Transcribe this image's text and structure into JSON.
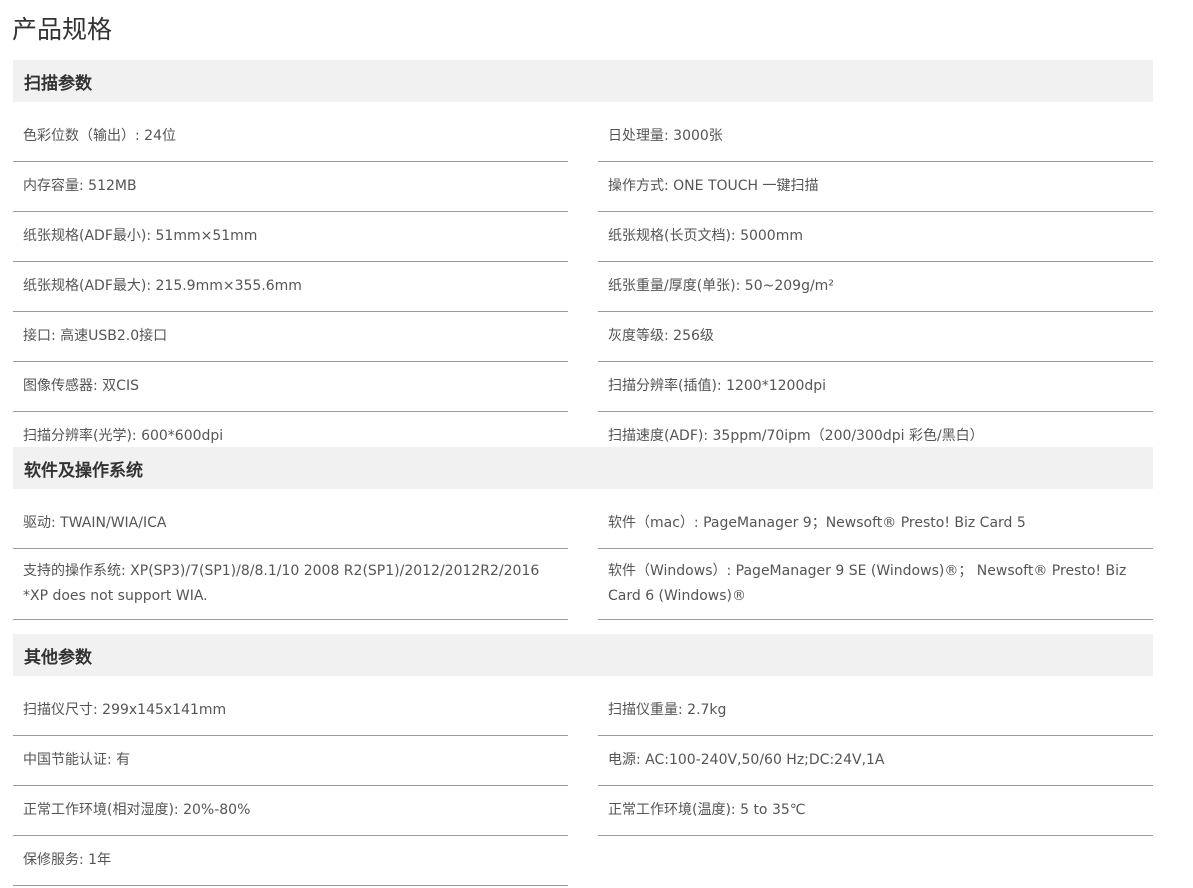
{
  "page": {
    "title": "产品规格"
  },
  "sections": [
    {
      "title": "扫描参数",
      "items": [
        "色彩位数（输出）: 24位",
        "日处理量: 3000张",
        "内存容量: 512MB",
        "操作方式: ONE TOUCH 一键扫描",
        "纸张规格(ADF最小): 51mm×51mm",
        "纸张规格(长页文档): 5000mm",
        "纸张规格(ADF最大): 215.9mm×355.6mm",
        "纸张重量/厚度(单张): 50~209g/m²",
        "接口: 高速USB2.0接口",
        "灰度等级: 256级",
        "图像传感器: 双CIS",
        "扫描分辨率(插值): 1200*1200dpi",
        "扫描分辨率(光学): 600*600dpi",
        "扫描速度(ADF): 35ppm/70ipm（200/300dpi 彩色/黑白）"
      ]
    },
    {
      "title": "软件及操作系统",
      "items": [
        "驱动: TWAIN/WIA/ICA",
        "软件（mac）: PageManager 9；Newsoft® Presto! Biz Card 5",
        "支持的操作系统: XP(SP3)/7(SP1)/8/8.1/10 2008 R2(SP1)/2012/2012R2/2016 *XP does not support WIA.",
        "软件（Windows）: PageManager 9 SE (Windows)®； Newsoft® Presto! Biz Card 6 (Windows)®"
      ]
    },
    {
      "title": "其他参数",
      "items": [
        "扫描仪尺寸: 299x145x141mm",
        "扫描仪重量: 2.7kg",
        "中国节能认证: 有",
        "电源: AC:100-240V,50/60 Hz;DC:24V,1A",
        "正常工作环境(相对湿度): 20%-80%",
        "正常工作环境(温度): 5 to 35℃",
        "保修服务: 1年"
      ]
    }
  ]
}
